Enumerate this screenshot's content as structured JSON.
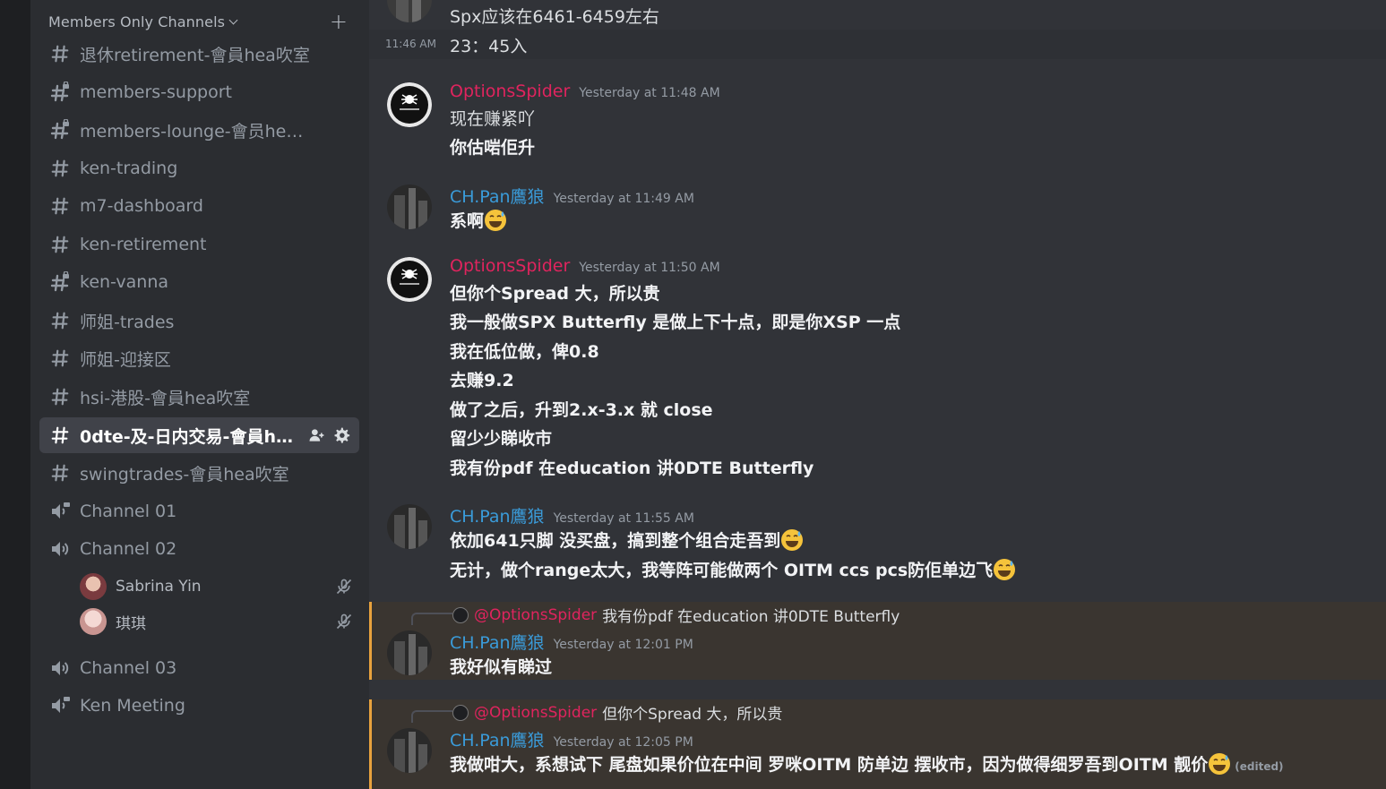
{
  "sidebar": {
    "category": "Members Only Channels",
    "channels": [
      {
        "name": "退休retirement-會員hea吹室",
        "icon": "hashtag-icon"
      },
      {
        "name": "members-support",
        "icon": "hashtag-lock-icon"
      },
      {
        "name": "members-lounge-會员hea吹室",
        "icon": "hashtag-lock-icon"
      },
      {
        "name": "ken-trading",
        "icon": "hashtag-icon"
      },
      {
        "name": "m7-dashboard",
        "icon": "hashtag-icon"
      },
      {
        "name": "ken-retirement",
        "icon": "hashtag-icon"
      },
      {
        "name": "ken-vanna",
        "icon": "hashtag-lock-icon"
      },
      {
        "name": "师姐-trades",
        "icon": "hashtag-icon"
      },
      {
        "name": "师姐-迎接区",
        "icon": "hashtag-icon"
      },
      {
        "name": "hsi-港股-會員hea吹室",
        "icon": "hashtag-icon"
      },
      {
        "name": "0dte-及-日内交易-會員hea吹室",
        "icon": "hashtag-icon"
      },
      {
        "name": "swingtrades-會員hea吹室",
        "icon": "hashtag-icon"
      },
      {
        "name": "Channel 01",
        "icon": "speaker-lock-icon"
      },
      {
        "name": "Channel 02",
        "icon": "speaker-icon"
      },
      {
        "name": "Channel 03",
        "icon": "speaker-icon"
      },
      {
        "name": "Ken Meeting",
        "icon": "speaker-lock-icon"
      }
    ],
    "voice_users": [
      {
        "name": "Sabrina Yin"
      },
      {
        "name": "琪琪"
      }
    ]
  },
  "chat": {
    "top_line": "Spx应该在6461-6459左右",
    "hover_time": "11:46 AM",
    "hover_text": "23：45入",
    "messages": [
      {
        "author": "OptionsSpider",
        "time": "Yesterday at 11:48 AM",
        "lines": [
          "现在赚紧吖",
          "你估啱佢升"
        ]
      },
      {
        "author": "CH.Pan鷹狼",
        "time": "Yesterday at 11:49 AM",
        "lines": [
          "系啊"
        ]
      },
      {
        "author": "OptionsSpider",
        "time": "Yesterday at 11:50 AM",
        "lines": [
          "但你个Spread 大，所以贵",
          "我一般做SPX Butterfly 是做上下十点，即是你XSP 一点",
          "我在低位做，俾0.8",
          "去赚9.2",
          "做了之后，升到2.x-3.x 就 close",
          "留少少睇收市",
          "我有份pdf 在education  讲0DTE Butterfly"
        ]
      },
      {
        "author": "CH.Pan鷹狼",
        "time": "Yesterday at 11:55 AM",
        "lines": [
          "依加641只脚 没买盘，搞到整个组合走吾到",
          "无计，做个range太大，我等阵可能做两个 OITM ccs pcs防佢单边飞"
        ]
      },
      {
        "author": "CH.Pan鷹狼",
        "time": "Yesterday at 12:01 PM",
        "reply_mention": "@OptionsSpider",
        "reply_text": "我有份pdf 在education  讲0DTE Butterfly",
        "lines": [
          "我好似有睇过"
        ]
      },
      {
        "author": "CH.Pan鷹狼",
        "time": "Yesterday at 12:05 PM",
        "reply_mention": "@OptionsSpider",
        "reply_text": "但你个Spread 大，所以贵",
        "lines": [
          "我做咁大，系想试下 尾盘如果价位在中间 罗咪OITM 防单边 摆收市，因为做得细罗吾到OITM 靓价"
        ],
        "edited": "(edited)"
      }
    ]
  },
  "colors": {
    "spider": "#e0245e",
    "pan": "#3a9bd9",
    "mention_bg": "#3a3530",
    "mention_bar": "#e8a23d"
  }
}
